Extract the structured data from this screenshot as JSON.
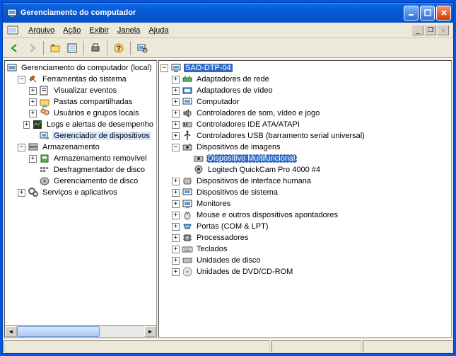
{
  "title": "Gerenciamento do computador",
  "menu": {
    "arquivo": "Arquivo",
    "acao": "Ação",
    "exibir": "Exibir",
    "janela": "Janela",
    "ajuda": "Ajuda"
  },
  "left_tree": {
    "root": "Gerenciamento do computador (local)",
    "system_tools": "Ferramentas do sistema",
    "event_viewer": "Visualizar eventos",
    "shared_folders": "Pastas compartilhadas",
    "users_groups": "Usuários e grupos locais",
    "perf_logs": "Logs e alertas de desempenho",
    "device_mgr": "Gerenciador de dispositivos",
    "storage": "Armazenamento",
    "removable": "Armazenamento removível",
    "defrag": "Desfragmentador de disco",
    "disk_mgmt": "Gerenciamento de disco",
    "services": "Serviços e aplicativos"
  },
  "right_tree": {
    "computer": "SAO-DTP-04",
    "net_adapters": "Adaptadores de rede",
    "video_adapters": "Adaptadores de vídeo",
    "computer_node": "Computador",
    "sound": "Controladores de som, vídeo e jogo",
    "ide": "Controladores IDE ATA/ATAPI",
    "usb": "Controladores USB (barramento serial universal)",
    "imaging": "Dispositivos de imagens",
    "multifunc": "Dispositivo Multifuncional",
    "webcam": "Logitech QuickCam Pro 4000 #4",
    "hid": "Dispositivos de interface humana",
    "system_devices": "Dispositivos de sistema",
    "monitors": "Monitores",
    "mice": "Mouse e outros dispositivos apontadores",
    "ports": "Portas (COM & LPT)",
    "processors": "Processadores",
    "keyboards": "Teclados",
    "disk_drives": "Unidades de disco",
    "dvd_drives": "Unidades de DVD/CD-ROM"
  },
  "toggle": {
    "plus": "+",
    "minus": "−"
  }
}
